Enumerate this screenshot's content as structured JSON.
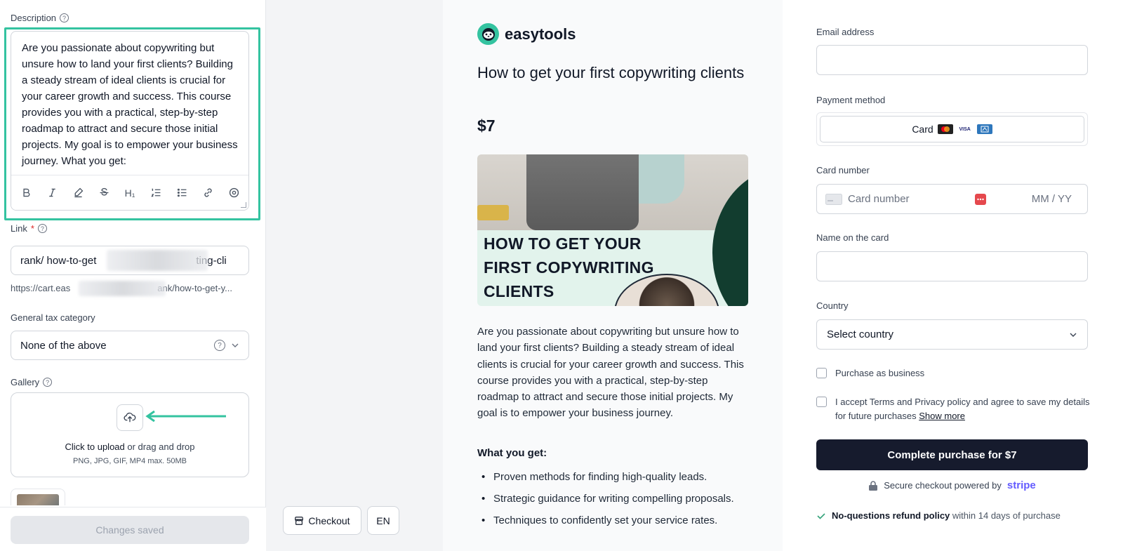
{
  "editor": {
    "description_label": "Description",
    "description_text": "Are you passionate about copywriting but unsure how to land your first clients? Building a steady stream of ideal clients is crucial for your career growth and success. This course provides you with a practical, step-by-step roadmap to attract and secure those initial projects. My goal is to empower your business journey. What you get:",
    "toolbar": [
      "bold",
      "italic",
      "highlight",
      "strikethrough",
      "heading-1",
      "ordered-list",
      "bullet-list",
      "link",
      "clear-format"
    ],
    "heading_glyph": "H₁",
    "link_label": "Link",
    "link_required": "*",
    "link_value_start": "rank/ how-to-get",
    "link_value_end": "ting-cli",
    "url_start": "https://cart.eas",
    "url_end": "ank/how-to-get-y...",
    "tax_label": "General tax category",
    "tax_value": "None of the above",
    "gallery_label": "Gallery",
    "upload_main": "Click to upload",
    "upload_rest": " or drag and drop",
    "upload_hint": "PNG, JPG, GIF, MP4 max. 50MB",
    "save_label": "Changes saved",
    "help_glyph": "?"
  },
  "preview_controls": {
    "checkout_label": "Checkout",
    "language_label": "EN"
  },
  "product": {
    "brand": "easytools",
    "title": "How to get your first copywriting clients",
    "price": "$7",
    "cover_line1": "HOW TO GET YOUR",
    "cover_line2": "FIRST COPYWRITING",
    "cover_line3": "CLIENTS",
    "description": "Are you passionate about copywriting but unsure how to land your first clients? Building a steady stream of ideal clients is crucial for your career growth and success. This course provides you with a practical, step-by-step roadmap to attract and secure those initial projects. My goal is to empower your business journey.",
    "what_you_get": "What you get:",
    "benefits": [
      "Proven methods for finding high-quality leads.",
      "Strategic guidance for writing compelling proposals.",
      "Techniques to confidently set your service rates."
    ]
  },
  "checkout": {
    "email_label": "Email address",
    "payment_label": "Payment method",
    "payment_option": "Card",
    "card_brands": [
      "mastercard",
      "VISA",
      "amex"
    ],
    "card_number_label": "Card number",
    "card_number_placeholder": "Card number",
    "expiry_placeholder": "MM / YY",
    "name_label": "Name on the card",
    "country_label": "Country",
    "country_value": "Select country",
    "business_label": "Purchase as business",
    "terms_text": "I accept Terms and Privacy policy and agree to save my details for future purchases ",
    "terms_link": "Show more",
    "complete_label": "Complete purchase for $7",
    "secure_text": "Secure checkout powered by",
    "stripe_label": "stripe",
    "refund_bold": "No-questions refund policy",
    "refund_rest": " within 14 days of purchase"
  },
  "colors": {
    "accent": "#34c3a0",
    "primary_button": "#161b2d",
    "stripe": "#635bff",
    "cover_dark": "#123d2f"
  }
}
